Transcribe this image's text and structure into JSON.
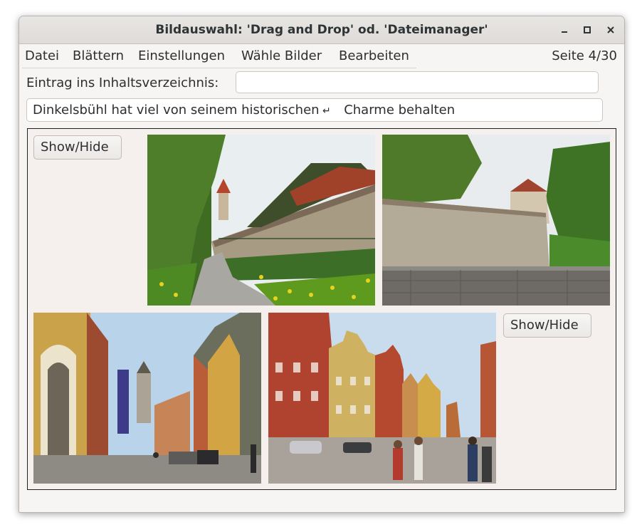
{
  "window": {
    "title": "Bildauswahl: 'Drag and Drop' od. 'Dateimanager'",
    "controls": [
      "minimize",
      "maximize",
      "close"
    ]
  },
  "menu": {
    "items": [
      "Datei",
      "Blättern",
      "Einstellungen",
      "Wähle Bilder",
      "Bearbeiten"
    ]
  },
  "page_indicator": "Seite 4/30",
  "toc": {
    "label": "Eintrag ins Inhaltsverzeichnis:",
    "value": "",
    "placeholder": ""
  },
  "caption": {
    "part1": "Dinkelsbühl hat viel von seinem historischen",
    "part2": "Charme behalten"
  },
  "buttons": {
    "show_hide_top": "Show/Hide",
    "show_hide_bottom": "Show/Hide"
  },
  "photos": [
    "town-wall-path",
    "town-wall-tower",
    "street-view",
    "market-square"
  ]
}
